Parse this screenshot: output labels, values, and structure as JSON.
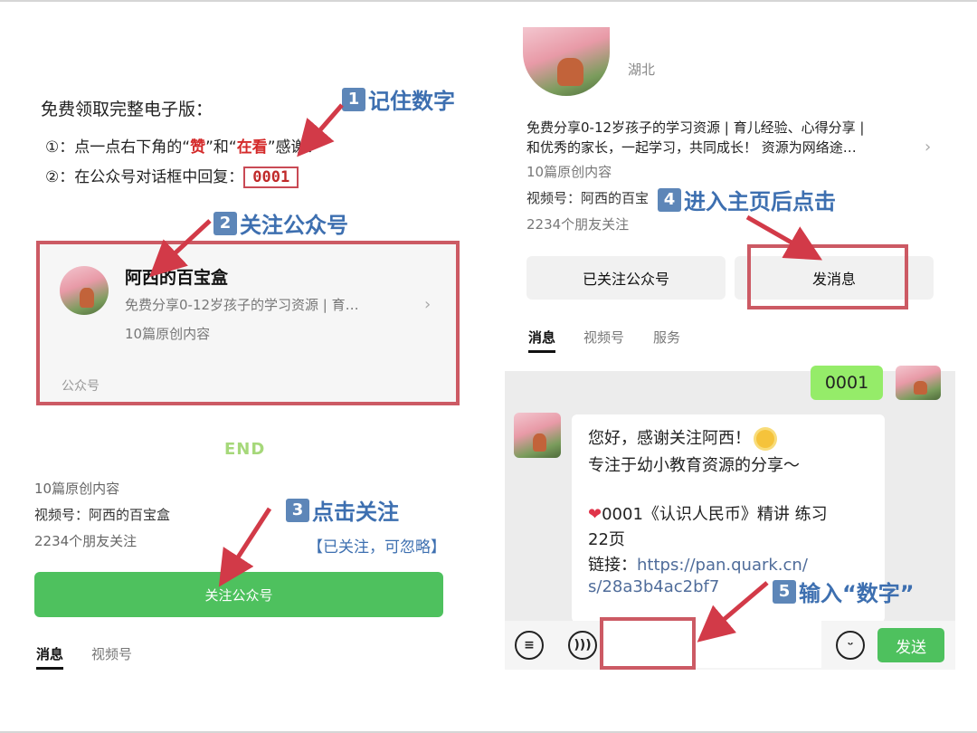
{
  "colors": {
    "accent_green": "#4ec15e",
    "annotation_blue": "#3d6fb0",
    "frame_red": "#cc5a64",
    "chat_green": "#95ec69"
  },
  "left": {
    "free_title": "免费领取完整电子版：",
    "step1": {
      "prefix": "①：点一点右下角的“",
      "like": "赞",
      "mid": "”和“",
      "watching": "在看",
      "suffix": "”感谢！"
    },
    "step2": {
      "text": "②：在公众号对话框中回复：",
      "code": "0001"
    },
    "card": {
      "name": "阿西的百宝盒",
      "desc": "免费分享0-12岁孩子的学习资源 | 育…",
      "count": "10篇原创内容",
      "type": "公众号"
    },
    "end_text": "END",
    "meta_count": "10篇原创内容",
    "meta_video": "视频号：阿西的百宝盒",
    "meta_friends": "2234个朋友关注",
    "follow_button": "关注公众号",
    "tabs": [
      "消息",
      "视频号"
    ]
  },
  "annotations": {
    "a1": {
      "num": "1",
      "text": "记住数字"
    },
    "a2": {
      "num": "2",
      "text": "关注公众号"
    },
    "a3": {
      "num": "3",
      "text": "点击关注"
    },
    "a3_note": "【已关注，可忽略】",
    "a4": {
      "num": "4",
      "text": "进入主页后点击"
    },
    "a5": {
      "num": "5",
      "text": "输入“数字”"
    }
  },
  "right": {
    "location": "湖北",
    "desc_line1": "免费分享0-12岁孩子的学习资源 | 育儿经验、心得分享 |",
    "desc_line2": "和优秀的家长，一起学习，共同成长！ 资源为网络途…",
    "count": "10篇原创内容",
    "video": "视频号：阿西的百宝",
    "friends": "2234个朋友关注",
    "followed_button": "已关注公众号",
    "message_button": "发消息",
    "tabs": [
      "消息",
      "视频号",
      "服务"
    ],
    "chat": {
      "user_message": "0001",
      "reply_line1": "您好，感谢关注阿西！",
      "reply_line2": "专注于幼小教育资源的分享～",
      "reply_item_code": "0001《认识人民币》精讲 练习",
      "reply_item_pages": "22页",
      "reply_link_label": "链接：",
      "reply_link_part1": "https://pan.quark.cn/",
      "reply_link_part2": "s/28a3b4ac2bf7"
    },
    "send_button": "发送"
  }
}
